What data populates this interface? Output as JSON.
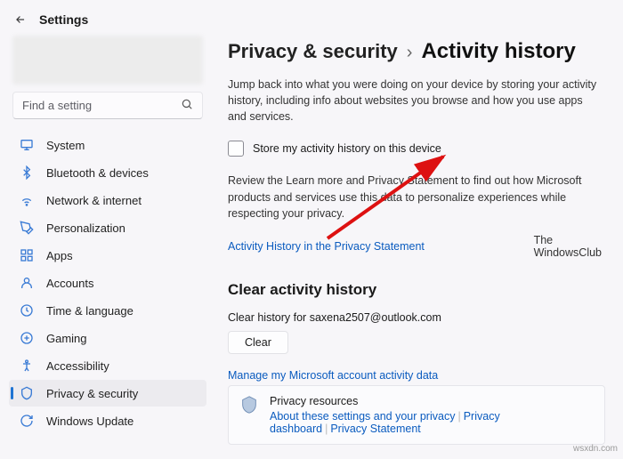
{
  "header": {
    "title": "Settings"
  },
  "search": {
    "placeholder": "Find a setting"
  },
  "sidebar": {
    "items": [
      {
        "label": "System"
      },
      {
        "label": "Bluetooth & devices"
      },
      {
        "label": "Network & internet"
      },
      {
        "label": "Personalization"
      },
      {
        "label": "Apps"
      },
      {
        "label": "Accounts"
      },
      {
        "label": "Time & language"
      },
      {
        "label": "Gaming"
      },
      {
        "label": "Accessibility"
      },
      {
        "label": "Privacy & security"
      },
      {
        "label": "Windows Update"
      }
    ]
  },
  "breadcrumb": {
    "parent": "Privacy & security",
    "sep": "›",
    "current": "Activity history"
  },
  "content": {
    "intro": "Jump back into what you were doing on your device by storing your activity history, including info about websites you browse and how you use apps and services.",
    "checkbox_label": "Store my activity history on this device",
    "review": "Review the Learn more and Privacy Statement to find out how Microsoft products and services use this data to personalize experiences while respecting your privacy.",
    "link_privacy": "Activity History in the Privacy Statement",
    "twc_line1": "The",
    "twc_line2": "WindowsClub",
    "clear_heading": "Clear activity history",
    "clear_for": "Clear history for saxena2507@outlook.com",
    "clear_button": "Clear",
    "manage_link": "Manage my Microsoft account activity data",
    "resources_title": "Privacy resources",
    "resources_links": [
      "About these settings and your privacy",
      "Privacy dashboard",
      "Privacy Statement"
    ]
  },
  "watermark": "wsxdn.com"
}
